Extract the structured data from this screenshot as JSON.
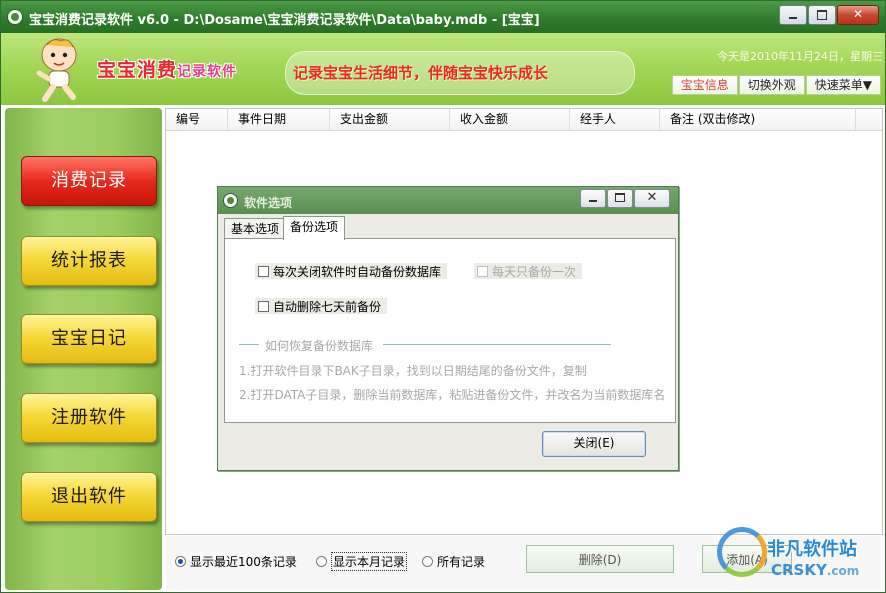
{
  "window": {
    "title": "宝宝消费记录软件 v6.0 - D:\\Dosame\\宝宝消费记录软件\\Data\\baby.mdb - [宝宝]"
  },
  "banner": {
    "logo_main": "宝宝消费",
    "logo_sub": "记录软件",
    "slogan": "记录宝宝生活细节，伴随宝宝快乐成长",
    "date": "今天是2010年11月24日，星期三",
    "buttons": [
      "宝宝信息",
      "切换外观",
      "快速菜单▼"
    ]
  },
  "sidebar": {
    "items": [
      {
        "label": "消费记录"
      },
      {
        "label": "统计报表"
      },
      {
        "label": "宝宝日记"
      },
      {
        "label": "注册软件"
      },
      {
        "label": "退出软件"
      }
    ]
  },
  "table": {
    "columns": [
      "编号",
      "事件日期",
      "支出金额",
      "收入金额",
      "经手人",
      "备注 (双击修改)"
    ]
  },
  "bottom": {
    "radios": [
      {
        "label": "显示最近100条记录",
        "selected": true
      },
      {
        "label": "显示本月记录",
        "selected": false
      },
      {
        "label": "所有记录",
        "selected": false
      }
    ],
    "delete_label": "删除(D)",
    "add_label": "添加(A)"
  },
  "dialog": {
    "title": "软件选项",
    "tabs": [
      "基本选项",
      "备份选项"
    ],
    "active_tab": "备份选项",
    "options": [
      {
        "label": "每次关闭软件时自动备份数据库",
        "checked": false,
        "enabled": true
      },
      {
        "label": "每天只备份一次",
        "checked": false,
        "enabled": false
      },
      {
        "label": "自动删除七天前备份",
        "checked": false,
        "enabled": true
      }
    ],
    "restore_title": "如何恢复备份数据库",
    "restore_steps": [
      "1.打开软件目录下BAK子目录，找到以日期结尾的备份文件，复制",
      "2.打开DATA子目录，删除当前数据库，粘贴进备份文件，并改名为当前数据库名"
    ],
    "close_label": "关闭(E)"
  },
  "watermark": {
    "name": "非凡软件站",
    "domain": "CRSKY",
    "tld": ".com"
  },
  "colors": {
    "title_bar": "#2e7a2c",
    "banner": "#a6d95a",
    "nav_active": "#e52a1c",
    "nav_button": "#f5d93a",
    "slogan": "#e8282d"
  }
}
